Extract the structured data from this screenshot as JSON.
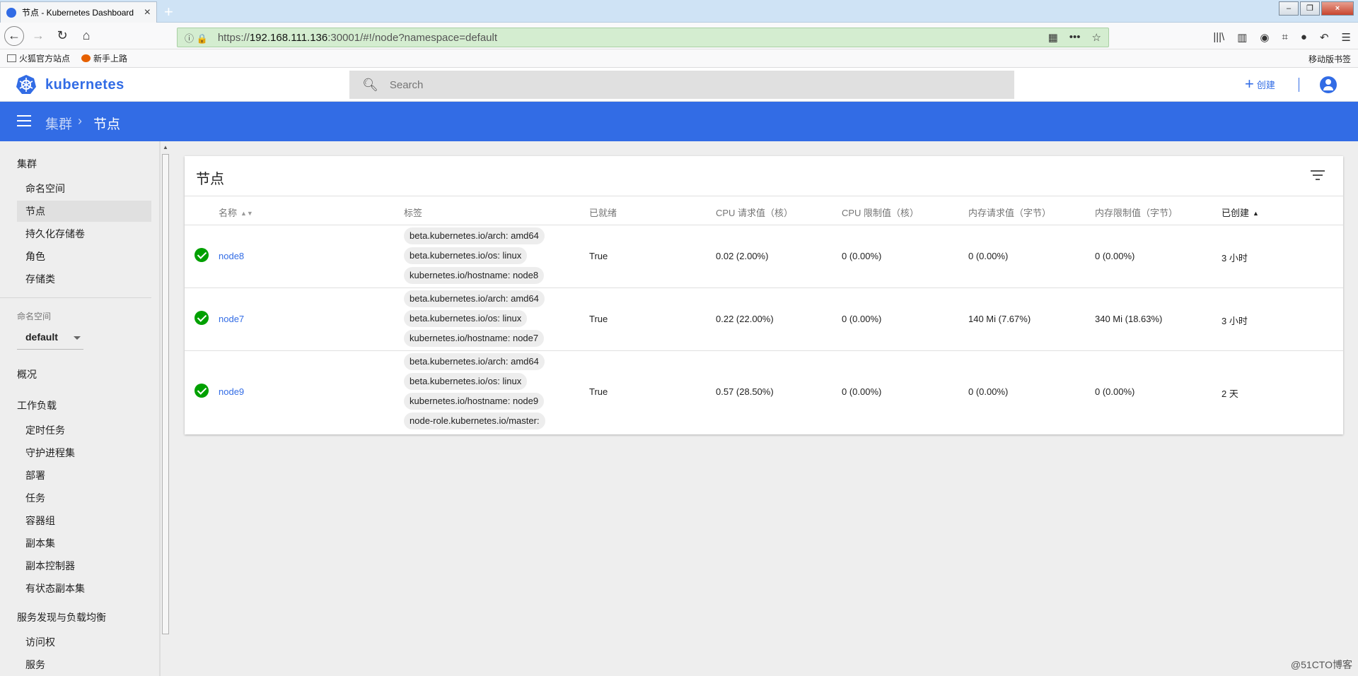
{
  "browser": {
    "tab_title": "节点 - Kubernetes Dashboard",
    "url_prefix": "https://",
    "url_host": "192.168.111.136",
    "url_rest": ":30001/#!/node?namespace=default",
    "bookmarks": [
      "火狐官方站点",
      "新手上路"
    ],
    "mobile_bookmarks": "移动版书签"
  },
  "header": {
    "brand": "kubernetes",
    "search_placeholder": "Search",
    "create_label": "创建"
  },
  "breadcrumb": {
    "parent": "集群",
    "current": "节点"
  },
  "sidebar": {
    "cluster": "集群",
    "cluster_items": [
      "命名空间",
      "节点",
      "持久化存储卷",
      "角色",
      "存储类"
    ],
    "namespace_label": "命名空间",
    "namespace_value": "default",
    "overview": "概况",
    "workloads": "工作负载",
    "workload_items": [
      "定时任务",
      "守护进程集",
      "部署",
      "任务",
      "容器组",
      "副本集",
      "副本控制器",
      "有状态副本集"
    ],
    "discovery": "服务发现与负载均衡",
    "discovery_items": [
      "访问权",
      "服务"
    ]
  },
  "card": {
    "title": "节点",
    "columns": [
      "名称",
      "标签",
      "已就绪",
      "CPU 请求值（核）",
      "CPU 限制值（核）",
      "内存请求值（字节）",
      "内存限制值（字节）",
      "已创建"
    ],
    "rows": [
      {
        "name": "node8",
        "labels": [
          "beta.kubernetes.io/arch: amd64",
          "beta.kubernetes.io/os: linux",
          "kubernetes.io/hostname: node8"
        ],
        "ready": "True",
        "cpu_req": "0.02 (2.00%)",
        "cpu_lim": "0 (0.00%)",
        "mem_req": "0 (0.00%)",
        "mem_lim": "0 (0.00%)",
        "created": "3 小时"
      },
      {
        "name": "node7",
        "labels": [
          "beta.kubernetes.io/arch: amd64",
          "beta.kubernetes.io/os: linux",
          "kubernetes.io/hostname: node7"
        ],
        "ready": "True",
        "cpu_req": "0.22 (22.00%)",
        "cpu_lim": "0 (0.00%)",
        "mem_req": "140 Mi (7.67%)",
        "mem_lim": "340 Mi (18.63%)",
        "created": "3 小时"
      },
      {
        "name": "node9",
        "labels": [
          "beta.kubernetes.io/arch: amd64",
          "beta.kubernetes.io/os: linux",
          "kubernetes.io/hostname: node9",
          "node-role.kubernetes.io/master:"
        ],
        "ready": "True",
        "cpu_req": "0.57 (28.50%)",
        "cpu_lim": "0 (0.00%)",
        "mem_req": "0 (0.00%)",
        "mem_lim": "0 (0.00%)",
        "created": "2 天"
      }
    ]
  },
  "watermark": "@51CTO博客",
  "colors": {
    "primary": "#326ce5",
    "ready": "#00a000"
  }
}
